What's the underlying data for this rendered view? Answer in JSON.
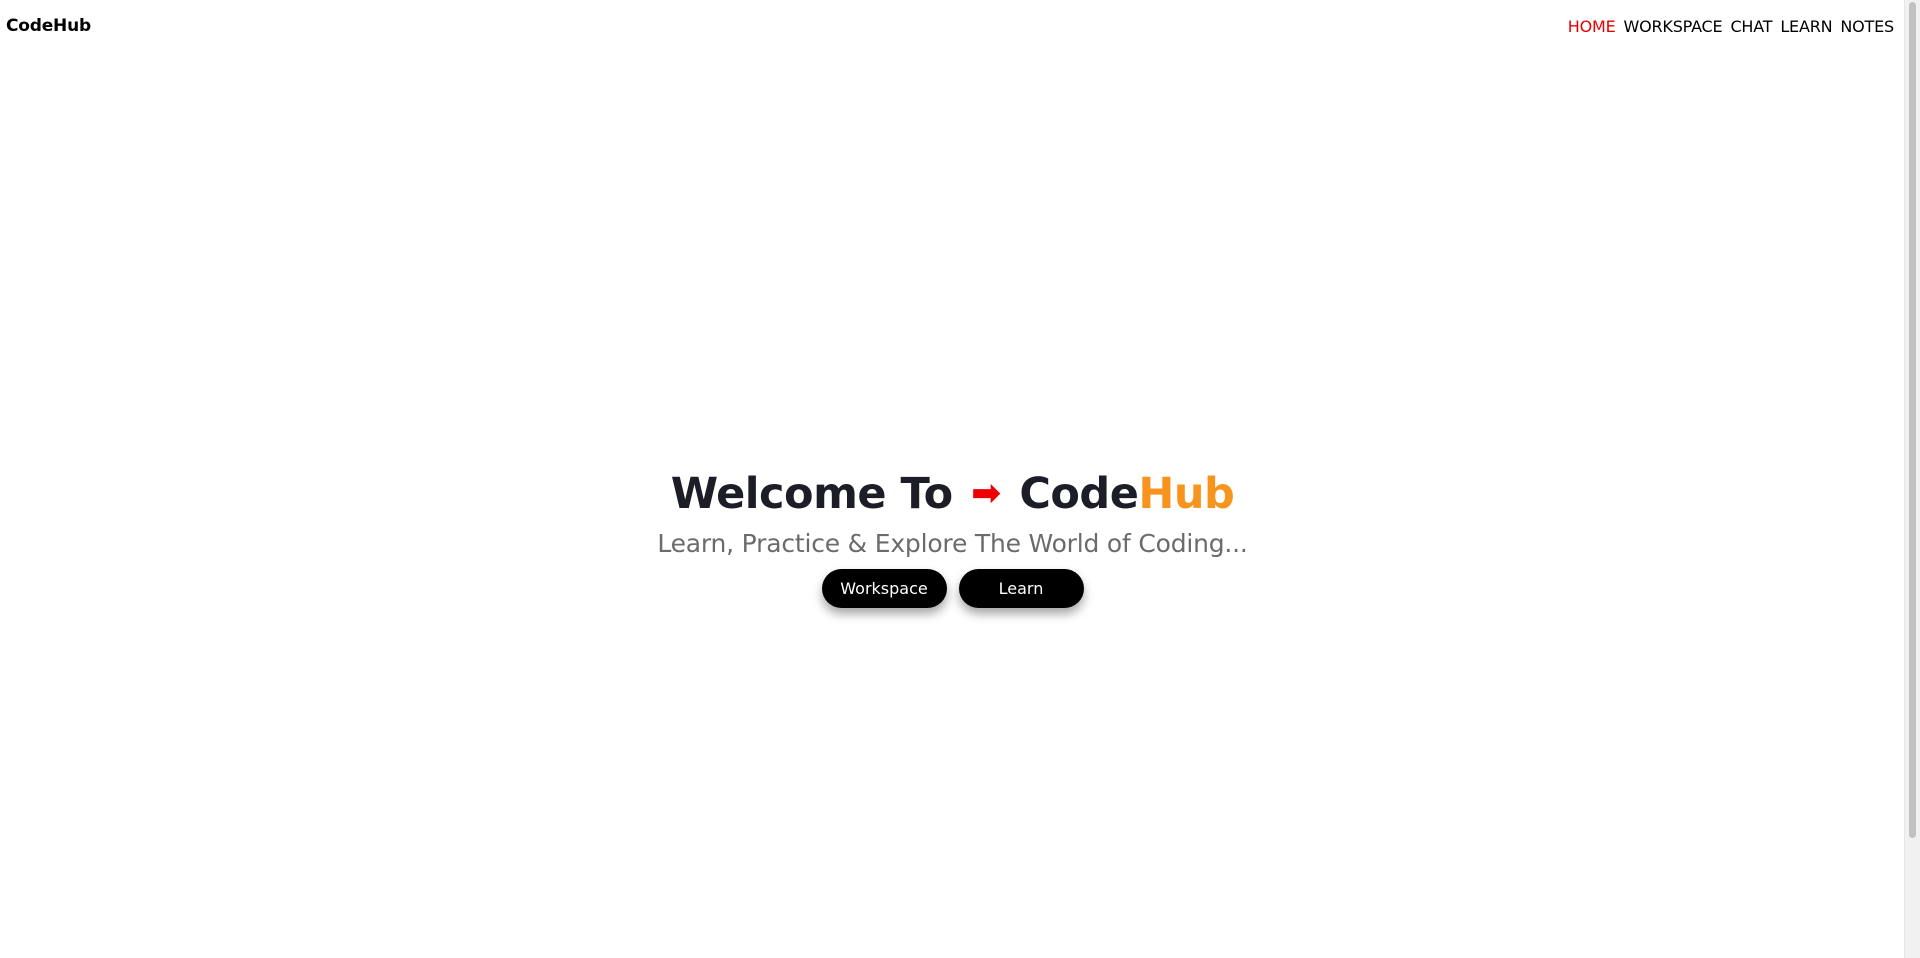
{
  "brand": "CodeHub",
  "nav": {
    "items": [
      {
        "label": "HOME",
        "active": true
      },
      {
        "label": "WORKSPACE",
        "active": false
      },
      {
        "label": "CHAT",
        "active": false
      },
      {
        "label": "LEARN",
        "active": false
      },
      {
        "label": "NOTES",
        "active": false
      }
    ]
  },
  "hero": {
    "title_prefix": "Welcome To",
    "arrow": "➡",
    "title_main": "Code",
    "title_accent": "Hub",
    "subtitle": "Learn, Practice & Explore The World of Coding...",
    "buttons": {
      "workspace": "Workspace",
      "learn": "Learn"
    }
  },
  "colors": {
    "active_nav": "#e60000",
    "accent": "#f7941d",
    "arrow": "#ee0000",
    "title": "#1c1d26",
    "subtitle": "#6b6b6b",
    "button_bg": "#000000"
  }
}
